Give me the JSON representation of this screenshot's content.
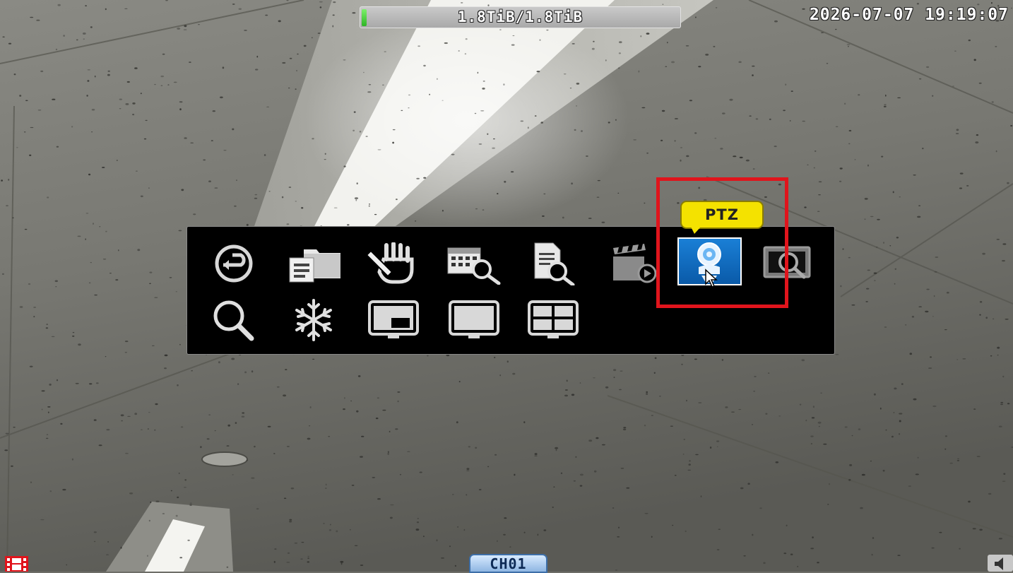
{
  "status_bar": {
    "hdd_usage_text": "1.8TiB/1.8TiB",
    "hdd_fill_fraction": 0.015,
    "datetime": "2026-07-07 19:19:07"
  },
  "popup_menu": {
    "row1": [
      {
        "icon": "back-return-icon"
      },
      {
        "icon": "folder-documents-icon"
      },
      {
        "icon": "manual-record-hand-icon"
      },
      {
        "icon": "calendar-search-icon"
      },
      {
        "icon": "document-search-icon"
      },
      {
        "icon": "clapperboard-play-icon"
      },
      {
        "icon": "ptz-camera-icon",
        "selected": true
      },
      {
        "icon": "monitor-zoom-icon"
      }
    ],
    "row2": [
      {
        "icon": "magnifier-icon"
      },
      {
        "icon": "snowflake-freeze-icon"
      },
      {
        "icon": "picture-in-picture-icon"
      },
      {
        "icon": "single-screen-icon"
      },
      {
        "icon": "quad-screen-icon"
      }
    ],
    "tooltip": "PTZ"
  },
  "channel": {
    "label": "CH01"
  },
  "colors": {
    "highlight": "#e0141c",
    "tooltip": "#f4e200",
    "selected_tile": "#0a5aa8",
    "hdd_fill": "#2fb526"
  }
}
